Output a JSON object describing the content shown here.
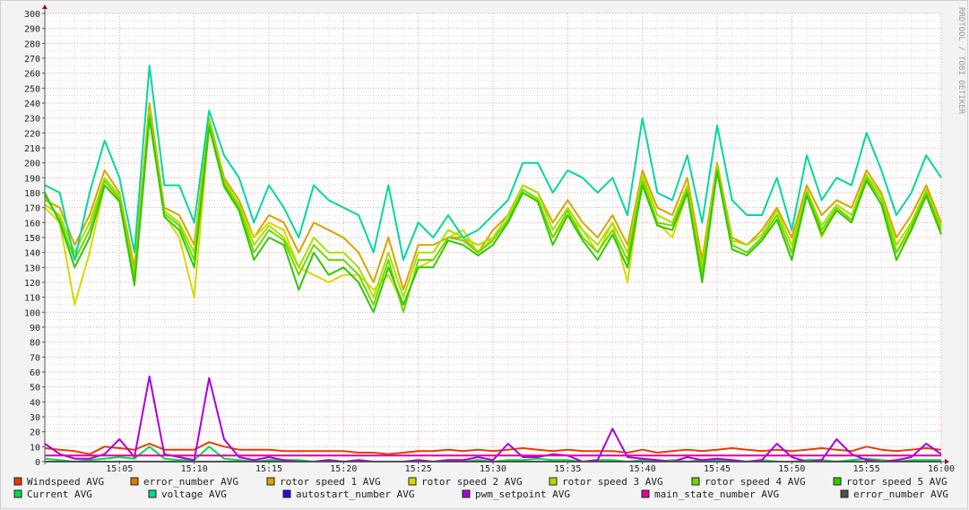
{
  "chart_data": {
    "type": "line",
    "title": "",
    "watermark": "RRDTOOL / TOBI OETIKER",
    "xlabel": "",
    "ylabel": "",
    "ylim": [
      0,
      300
    ],
    "y_ticks": [
      0,
      10,
      20,
      30,
      40,
      50,
      60,
      70,
      80,
      90,
      100,
      110,
      120,
      130,
      140,
      150,
      160,
      170,
      180,
      190,
      200,
      210,
      220,
      230,
      240,
      250,
      260,
      270,
      280,
      290,
      300
    ],
    "x_range_minutes": [
      0,
      60
    ],
    "x_ticks": [
      {
        "minute": 5,
        "label": "15:05"
      },
      {
        "minute": 10,
        "label": "15:10"
      },
      {
        "minute": 15,
        "label": "15:15"
      },
      {
        "minute": 20,
        "label": "15:20"
      },
      {
        "minute": 25,
        "label": "15:25"
      },
      {
        "minute": 30,
        "label": "15:30"
      },
      {
        "minute": 35,
        "label": "15:35"
      },
      {
        "minute": 40,
        "label": "15:40"
      },
      {
        "minute": 45,
        "label": "15:45"
      },
      {
        "minute": 50,
        "label": "15:50"
      },
      {
        "minute": 55,
        "label": "15:55"
      },
      {
        "minute": 60,
        "label": "16:00"
      }
    ],
    "grid": true,
    "legend_position": "bottom",
    "series": [
      {
        "name": "Windspeed AVG",
        "color": "#e63c00",
        "values": [
          9,
          8,
          7,
          5,
          10,
          9,
          8,
          12,
          8,
          8,
          8,
          13,
          10,
          8,
          8,
          8,
          7,
          7,
          7,
          7,
          7,
          6,
          6,
          5,
          6,
          7,
          7,
          8,
          7,
          8,
          7,
          8,
          9,
          8,
          7,
          8,
          7,
          7,
          7,
          6,
          8,
          6,
          7,
          8,
          7,
          8,
          9,
          8,
          7,
          8,
          7,
          8,
          9,
          8,
          7,
          10,
          8,
          7,
          8,
          9,
          8
        ]
      },
      {
        "name": "error_number AVG",
        "color": "#e07800",
        "values": [
          0,
          0,
          0,
          0,
          0,
          0,
          0,
          0,
          0,
          0,
          0,
          0,
          0,
          0,
          0,
          0,
          0,
          0,
          0,
          0,
          0,
          0,
          0,
          0,
          0,
          0,
          0,
          0,
          0,
          0,
          0,
          0,
          0,
          0,
          0,
          0,
          0,
          0,
          0,
          0,
          0,
          0,
          0,
          0,
          0,
          0,
          0,
          0,
          0,
          0,
          0,
          0,
          0,
          0,
          0,
          0,
          0,
          0,
          0,
          0,
          0
        ]
      },
      {
        "name": "rotor speed 1 AVG",
        "color": "#d8a400",
        "values": [
          175,
          170,
          145,
          165,
          195,
          180,
          130,
          240,
          170,
          165,
          145,
          230,
          190,
          175,
          150,
          165,
          160,
          140,
          160,
          155,
          150,
          140,
          120,
          150,
          115,
          145,
          145,
          150,
          150,
          140,
          155,
          165,
          185,
          180,
          160,
          175,
          160,
          150,
          165,
          145,
          195,
          170,
          165,
          190,
          135,
          200,
          150,
          145,
          155,
          170,
          150,
          185,
          165,
          175,
          170,
          195,
          180,
          150,
          165,
          185,
          160
        ]
      },
      {
        "name": "rotor speed 2 AVG",
        "color": "#d8d800",
        "values": [
          170,
          160,
          105,
          140,
          185,
          175,
          120,
          230,
          165,
          150,
          110,
          225,
          185,
          170,
          150,
          160,
          155,
          130,
          125,
          120,
          125,
          125,
          115,
          125,
          105,
          130,
          135,
          150,
          155,
          140,
          150,
          160,
          180,
          175,
          150,
          165,
          155,
          140,
          160,
          120,
          190,
          160,
          150,
          180,
          125,
          195,
          145,
          140,
          150,
          165,
          140,
          180,
          150,
          170,
          160,
          190,
          175,
          140,
          155,
          180,
          155
        ]
      },
      {
        "name": "rotor speed 3 AVG",
        "color": "#a8e000",
        "values": [
          172,
          165,
          140,
          160,
          190,
          178,
          125,
          235,
          168,
          160,
          140,
          228,
          188,
          172,
          145,
          158,
          150,
          130,
          150,
          140,
          140,
          130,
          110,
          140,
          110,
          140,
          140,
          155,
          150,
          145,
          150,
          165,
          185,
          180,
          155,
          170,
          155,
          145,
          160,
          140,
          192,
          165,
          160,
          185,
          130,
          198,
          148,
          145,
          152,
          168,
          145,
          182,
          158,
          172,
          165,
          192,
          178,
          145,
          160,
          182,
          158
        ]
      },
      {
        "name": "rotor speed 4 AVG",
        "color": "#70d800",
        "values": [
          178,
          162,
          135,
          155,
          188,
          176,
          122,
          232,
          166,
          158,
          135,
          226,
          186,
          170,
          140,
          155,
          148,
          125,
          145,
          135,
          135,
          125,
          105,
          135,
          100,
          135,
          135,
          150,
          148,
          140,
          148,
          162,
          182,
          176,
          150,
          168,
          150,
          140,
          155,
          135,
          188,
          160,
          158,
          182,
          125,
          196,
          145,
          140,
          150,
          165,
          140,
          180,
          155,
          170,
          162,
          190,
          175,
          140,
          158,
          180,
          155
        ]
      },
      {
        "name": "rotor speed 5 AVG",
        "color": "#33c800",
        "values": [
          180,
          160,
          130,
          150,
          185,
          174,
          118,
          230,
          164,
          155,
          130,
          224,
          184,
          168,
          135,
          150,
          145,
          115,
          140,
          125,
          130,
          120,
          100,
          130,
          105,
          130,
          130,
          148,
          145,
          138,
          145,
          160,
          180,
          174,
          145,
          165,
          148,
          135,
          152,
          130,
          185,
          158,
          155,
          180,
          120,
          194,
          142,
          138,
          148,
          162,
          135,
          178,
          152,
          168,
          160,
          188,
          172,
          135,
          155,
          178,
          152
        ]
      },
      {
        "name": "Current AVG",
        "color": "#00dd44",
        "values": [
          2,
          1,
          0,
          1,
          2,
          3,
          2,
          10,
          2,
          1,
          1,
          10,
          2,
          1,
          0,
          1,
          1,
          1,
          0,
          1,
          0,
          0,
          0,
          0,
          0,
          0,
          0,
          1,
          0,
          1,
          0,
          1,
          1,
          2,
          1,
          1,
          0,
          1,
          1,
          0,
          1,
          0,
          1,
          0,
          1,
          1,
          0,
          0,
          1,
          0,
          0,
          1,
          1,
          0,
          1,
          2,
          1,
          0,
          1,
          1,
          1
        ]
      },
      {
        "name": "voltage AVG",
        "color": "#00d8a0",
        "values": [
          185,
          180,
          135,
          180,
          215,
          190,
          140,
          265,
          185,
          185,
          160,
          235,
          205,
          190,
          160,
          185,
          170,
          150,
          185,
          175,
          170,
          165,
          140,
          185,
          135,
          160,
          150,
          165,
          150,
          155,
          165,
          175,
          200,
          200,
          180,
          195,
          190,
          180,
          190,
          165,
          230,
          180,
          175,
          205,
          160,
          225,
          175,
          165,
          165,
          190,
          155,
          205,
          175,
          190,
          185,
          220,
          195,
          165,
          180,
          205,
          190
        ]
      },
      {
        "name": "autostart_number AVG",
        "color": "#3300dd",
        "values": [
          0,
          0,
          0,
          0,
          0,
          0,
          0,
          0,
          0,
          0,
          0,
          0,
          0,
          0,
          0,
          0,
          0,
          0,
          0,
          0,
          0,
          0,
          0,
          0,
          0,
          0,
          0,
          0,
          0,
          0,
          0,
          0,
          0,
          0,
          0,
          0,
          0,
          0,
          0,
          0,
          0,
          0,
          0,
          0,
          0,
          0,
          0,
          0,
          0,
          0,
          0,
          0,
          0,
          0,
          0,
          0,
          0,
          0,
          0,
          0,
          0
        ]
      },
      {
        "name": "pwm_setpoint AVG",
        "color": "#aa00dd",
        "values": [
          12,
          5,
          2,
          2,
          5,
          15,
          3,
          57,
          5,
          3,
          1,
          56,
          15,
          3,
          1,
          3,
          1,
          0,
          0,
          1,
          0,
          1,
          0,
          0,
          0,
          1,
          0,
          1,
          1,
          3,
          1,
          12,
          3,
          3,
          5,
          4,
          0,
          1,
          22,
          3,
          2,
          1,
          0,
          3,
          1,
          2,
          1,
          0,
          1,
          12,
          3,
          0,
          1,
          15,
          5,
          1,
          0,
          1,
          3,
          12,
          5
        ]
      },
      {
        "name": "main_state_number AVG",
        "color": "#e000a8",
        "values": [
          4,
          4,
          4,
          4,
          4,
          4,
          4,
          4,
          4,
          4,
          4,
          4,
          4,
          4,
          4,
          4,
          4,
          4,
          4,
          4,
          4,
          4,
          4,
          4,
          4,
          4,
          4,
          4,
          4,
          4,
          4,
          4,
          4,
          4,
          4,
          4,
          4,
          4,
          4,
          4,
          4,
          4,
          4,
          4,
          4,
          4,
          4,
          4,
          4,
          4,
          4,
          4,
          4,
          4,
          4,
          4,
          4,
          4,
          4,
          4,
          4
        ]
      },
      {
        "name": "error_number AVG",
        "color": "#505050",
        "values": [
          0,
          0,
          0,
          0,
          0,
          0,
          0,
          0,
          0,
          0,
          0,
          0,
          0,
          0,
          0,
          0,
          0,
          0,
          0,
          0,
          0,
          0,
          0,
          0,
          0,
          0,
          0,
          0,
          0,
          0,
          0,
          0,
          0,
          0,
          0,
          0,
          0,
          0,
          0,
          0,
          0,
          0,
          0,
          0,
          0,
          0,
          0,
          0,
          0,
          0,
          0,
          0,
          0,
          0,
          0,
          0,
          0,
          0,
          0,
          0,
          0
        ]
      }
    ]
  }
}
